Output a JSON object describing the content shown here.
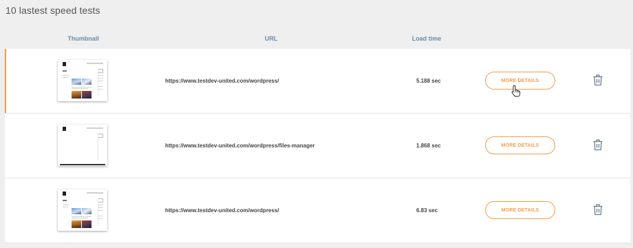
{
  "page_title": "10 lastest speed tests",
  "columns": {
    "thumbnail": "Thumbnail",
    "url": "URL",
    "load_time": "Load time"
  },
  "rows": [
    {
      "url": "https://www.testdev-united.com/wordpress/",
      "load_time": "5.188 sec",
      "button": "MORE DETAILS",
      "thumbnail_icon": "site-thumbnail"
    },
    {
      "url": "https://www.testdev-united.com/wordpress/files-manager",
      "load_time": "1.868 sec",
      "button": "MORE DETAILS",
      "thumbnail_icon": "site-thumbnail-blank"
    },
    {
      "url": "https://www.testdev-united.com/wordpress/",
      "load_time": "6.83 sec",
      "button": "MORE DETAILS",
      "thumbnail_icon": "site-thumbnail"
    }
  ],
  "icons": {
    "delete": "trash-icon",
    "cursor": "hand-pointer-cursor"
  },
  "colors": {
    "accent": "#f59b4a",
    "header_text": "#6c8aa6",
    "icon_gray": "#6b7e90",
    "background": "#efefef"
  }
}
